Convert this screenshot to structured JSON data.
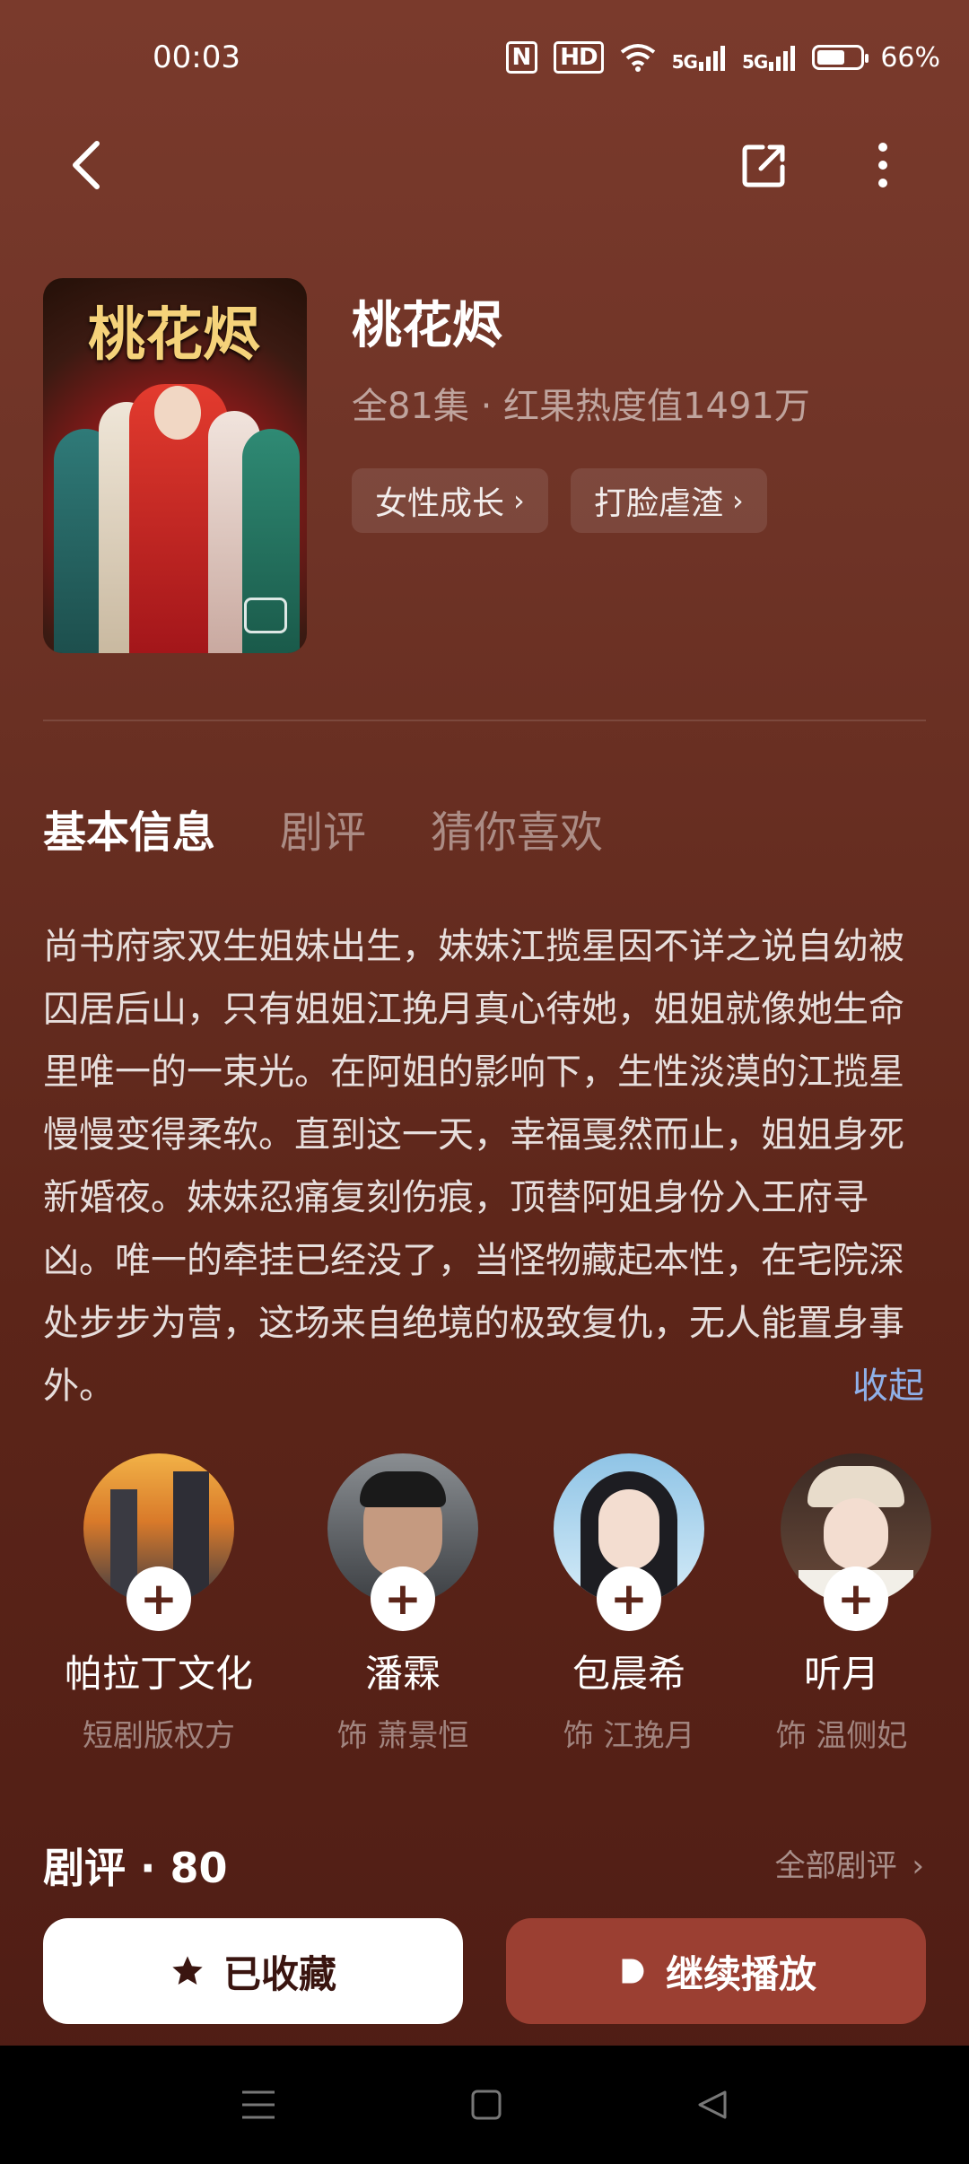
{
  "status": {
    "time": "00:03",
    "net1": "HD",
    "sig1": "5G",
    "sig2": "5G",
    "battery": "66%",
    "battery_level": 0.66
  },
  "drama": {
    "poster_title": "桃花烬",
    "title": "桃花烬",
    "meta": "全81集 · 红果热度值1491万",
    "tags": [
      "女性成长",
      "打脸虐渣"
    ]
  },
  "tabs": [
    "基本信息",
    "剧评",
    "猜你喜欢"
  ],
  "description": "尚书府家双生姐妹出生，妹妹江揽星因不详之说自幼被囚居后山，只有姐姐江挽月真心待她，姐姐就像她生命里唯一的一束光。在阿姐的影响下，生性淡漠的江揽星慢慢变得柔软。直到这一天，幸福戛然而止，姐姐身死新婚夜。妹妹忍痛复刻伤痕，顶替阿姐身份入王府寻凶。唯一的牵挂已经没了，当怪物藏起本性，在宅院深处步步为营，这场来自绝境的极致复仇，无人能置身事外。",
  "collapse_label": "收起",
  "people": [
    {
      "name": "帕拉丁文化",
      "role": "短剧版权方"
    },
    {
      "name": "潘霖",
      "role": "饰 萧景恒"
    },
    {
      "name": "包晨希",
      "role": "饰 江挽月"
    },
    {
      "name": "听月",
      "role": "饰 温侧妃"
    }
  ],
  "reviews": {
    "title": "剧评 · 80",
    "all_label": "全部剧评"
  },
  "buttons": {
    "favorite": "已收藏",
    "play": "继续播放"
  }
}
